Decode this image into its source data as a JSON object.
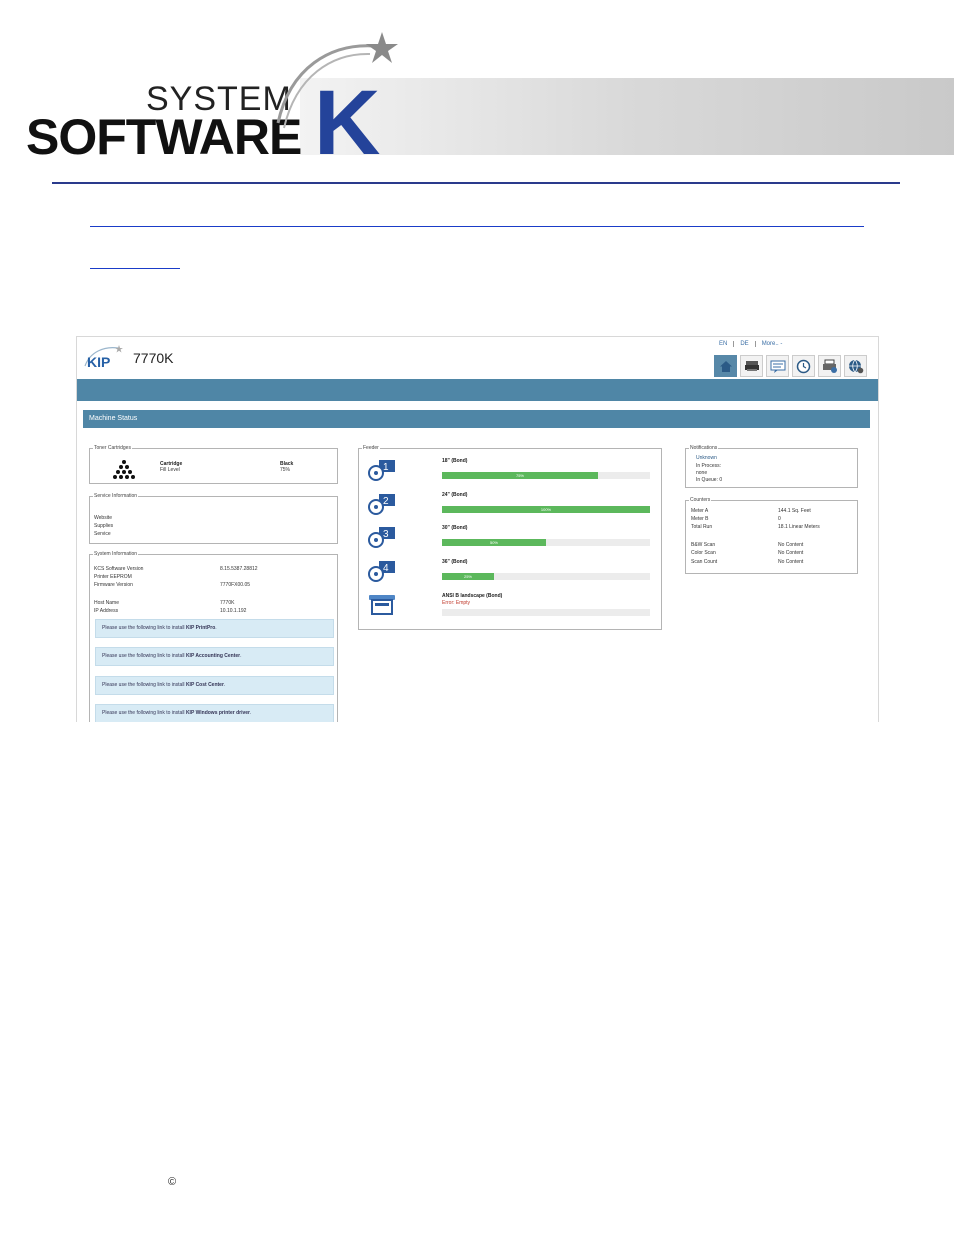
{
  "header": {
    "brand_line1": "SYSTEM",
    "brand_line2": "SOFTWARE",
    "brand_k": "K"
  },
  "screenshot": {
    "logo_text": "KIP",
    "model": "7770K",
    "languages": [
      "EN",
      "DE",
      "More.. -"
    ],
    "nav_icons": [
      "home-icon",
      "printer-queue-icon",
      "messages-icon",
      "history-clock-icon",
      "printer-settings-icon",
      "globe-settings-icon"
    ],
    "section_title": "Machine Status",
    "toner": {
      "legend": "Toner Cartridges",
      "cartridge_label": "Cartridge",
      "fill_label": "Fill Level",
      "color": "Black",
      "fill": "75%"
    },
    "service": {
      "legend": "Service Information",
      "rows": [
        "Website",
        "Supplies",
        "Service"
      ]
    },
    "system": {
      "legend": "System Information",
      "rows": [
        {
          "label": "KCS Software Version",
          "value": "8.15.5387.28812"
        },
        {
          "label": "Printer EEPROM",
          "value": ""
        },
        {
          "label": "Firmware Version",
          "value": "7770FX00.05"
        },
        {
          "label": "Host Name",
          "value": "7770K"
        },
        {
          "label": "IP Address",
          "value": "10.10.1.192"
        }
      ],
      "install_links": [
        {
          "prefix": "Please use the following link to install ",
          "product": "KIP PrintPro",
          "suffix": "."
        },
        {
          "prefix": "Please use the following link to install ",
          "product": "KIP Accounting Center",
          "suffix": "."
        },
        {
          "prefix": "Please use the following link to install ",
          "product": "KIP Cost Center",
          "suffix": "."
        },
        {
          "prefix": "Please use the following link to install ",
          "product": "KIP Windows printer driver",
          "suffix": "."
        }
      ]
    },
    "feeder": {
      "legend": "Feeder",
      "rolls": [
        {
          "number": "1",
          "label": "18\" (Bond)",
          "level": 0.75,
          "text": "75%"
        },
        {
          "number": "2",
          "label": "24\" (Bond)",
          "level": 1.0,
          "text": "100%"
        },
        {
          "number": "3",
          "label": "30\" (Bond)",
          "level": 0.5,
          "text": "50%"
        },
        {
          "number": "4",
          "label": "36\" (Bond)",
          "level": 0.25,
          "text": "25%"
        }
      ],
      "sheet": {
        "label": "ANSI B landscape (Bond)",
        "error": "Error: Empty"
      }
    },
    "notifications": {
      "legend": "Notifications",
      "status": "Unknown",
      "in_process_label": "In Process:",
      "in_process_value": "none",
      "in_queue": "In Queue: 0"
    },
    "counters": {
      "legend": "Counters",
      "rows": [
        {
          "label": "Meter A",
          "value": "144.1 Sq. Feet"
        },
        {
          "label": "Meter B",
          "value": "0"
        },
        {
          "label": "Total Run",
          "value": "18.1 Linear Meters"
        },
        {
          "label": "B&W Scan",
          "value": "No Content"
        },
        {
          "label": "Color Scan",
          "value": "No Content"
        },
        {
          "label": "Scan Count",
          "value": "No Content"
        }
      ]
    }
  },
  "footer": {
    "copyright": "©"
  },
  "colors": {
    "header_blue": "#4f86a6",
    "progress_green": "#5cb85c",
    "link_blue": "#1a3cc8",
    "error_red": "#c0392b"
  }
}
